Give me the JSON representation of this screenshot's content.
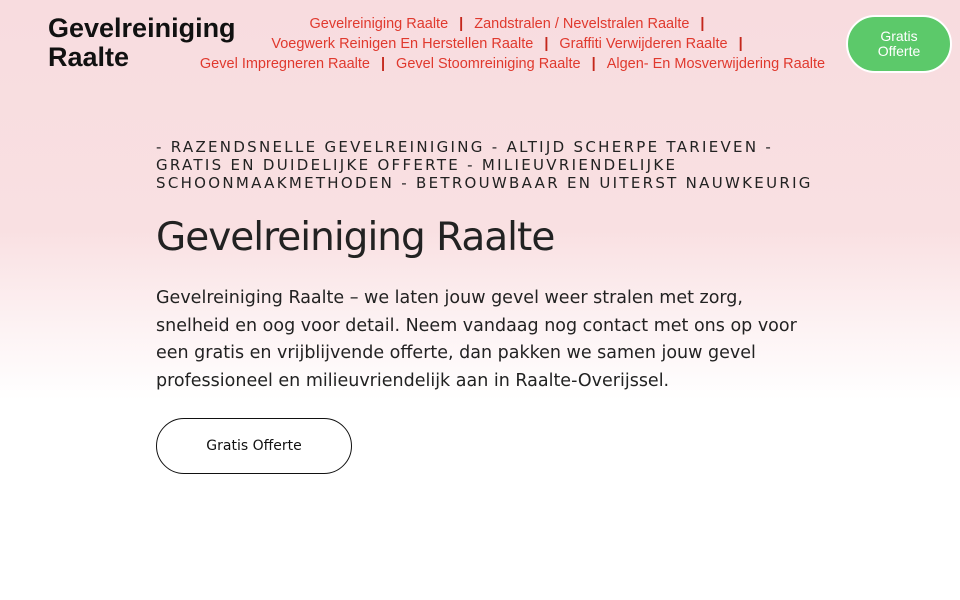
{
  "header": {
    "logo_line1": "Gevelreiniging",
    "logo_line2": "Raalte",
    "nav": [
      "Gevelreiniging Raalte",
      "Zandstralen / Nevelstralen Raalte",
      "Voegwerk Reinigen En Herstellen Raalte",
      "Graffiti Verwijderen Raalte",
      "Gevel Impregneren Raalte",
      "Gevel Stoomreiniging Raalte",
      "Algen- En Mosverwijdering Raalte"
    ],
    "separator": "|",
    "cta_line1": "Gratis",
    "cta_line2": "Offerte"
  },
  "hero": {
    "tagline": "- Razendsnelle gevelreiniging - Altijd scherpe tarieven - Gratis en duidelijke offerte - Milieuvriendelijke schoonmaakmethoden - Betrouwbaar en uiterst nauwkeurig",
    "title": "Gevelreiniging Raalte",
    "intro": "Gevelreiniging Raalte – we laten jouw gevel weer stralen met zorg, snelheid en oog voor detail. Neem vandaag nog contact met ons op voor een gratis en vrijblijvende offerte, dan pakken we samen jouw gevel professioneel en milieuvriendelijk aan in Raalte-Overijssel.",
    "cta_label": "Gratis Offerte"
  },
  "colors": {
    "nav_link": "#e0392e",
    "cta_green": "#5cc96a",
    "hero_bg_top": "#f8dcdf",
    "text": "#222222"
  }
}
